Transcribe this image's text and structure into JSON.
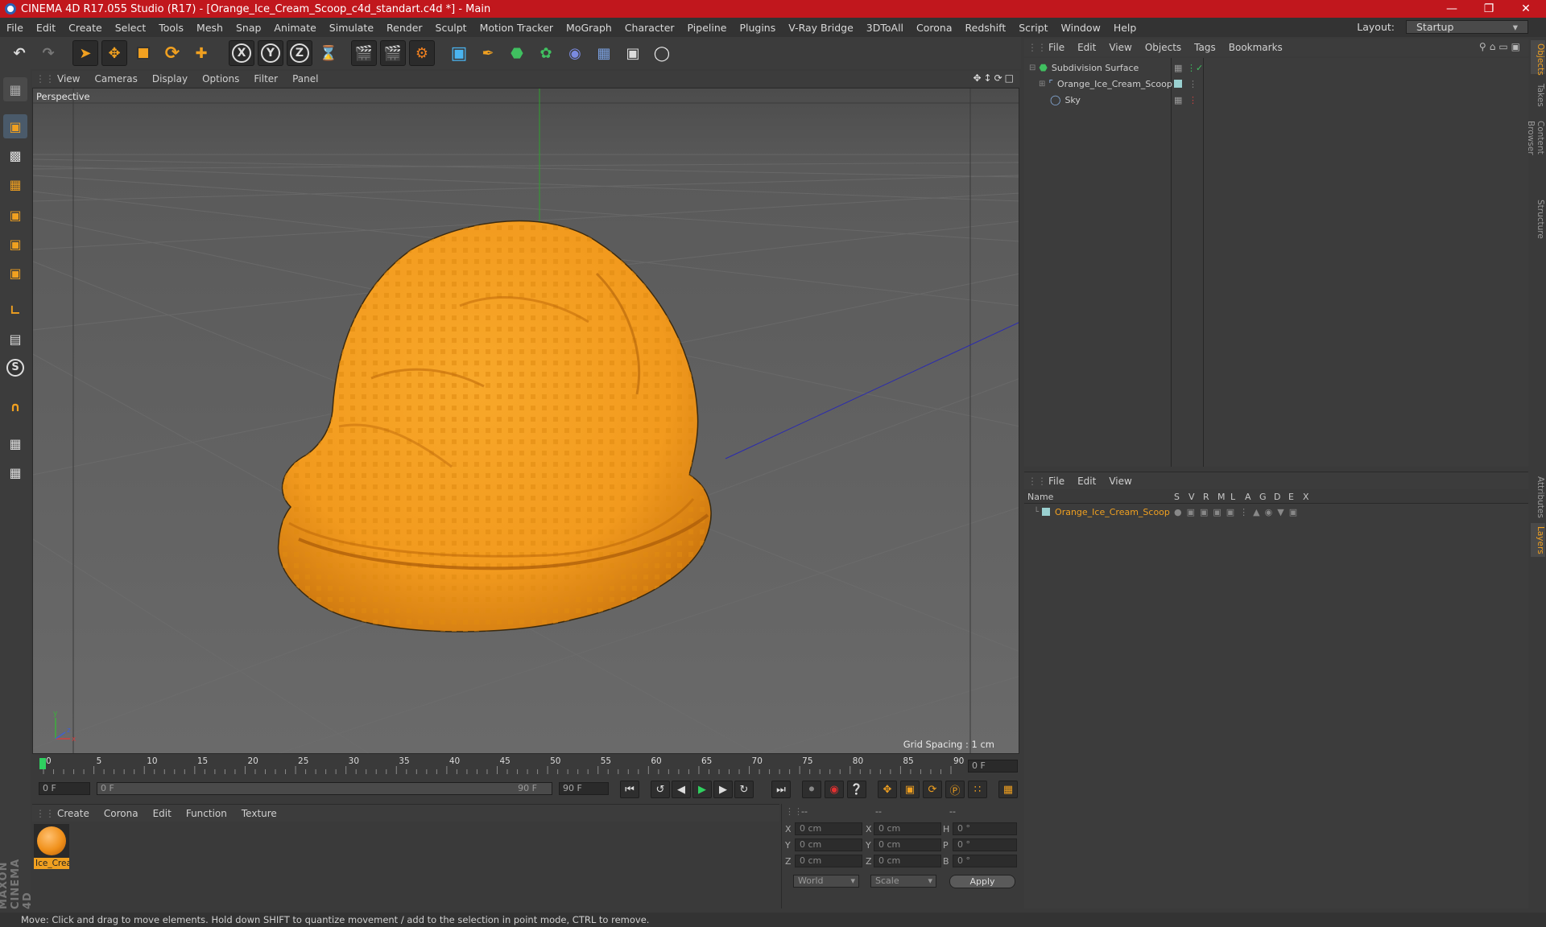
{
  "window": {
    "title": "CINEMA 4D R17.055 Studio (R17) - [Orange_Ice_Cream_Scoop_c4d_standart.c4d *] - Main"
  },
  "menubar": {
    "items": [
      "File",
      "Edit",
      "Create",
      "Select",
      "Tools",
      "Mesh",
      "Snap",
      "Animate",
      "Simulate",
      "Render",
      "Sculpt",
      "Motion Tracker",
      "MoGraph",
      "Character",
      "Pipeline",
      "Plugins",
      "V-Ray Bridge",
      "3DToAll",
      "Corona",
      "Redshift",
      "Script",
      "Window",
      "Help"
    ],
    "layout_label": "Layout:",
    "layout_value": "Startup"
  },
  "viewport": {
    "menu": [
      "View",
      "Cameras",
      "Display",
      "Options",
      "Filter",
      "Panel"
    ],
    "camera_label": "Perspective",
    "grid_spacing": "Grid Spacing : 1 cm"
  },
  "timeline": {
    "ticks": [
      "0",
      "5",
      "10",
      "15",
      "20",
      "25",
      "30",
      "35",
      "40",
      "45",
      "50",
      "55",
      "60",
      "65",
      "70",
      "75",
      "80",
      "85",
      "90"
    ],
    "current_frame": "0 F",
    "start_field": "0 F",
    "range_start": "0 F",
    "range_end": "90 F",
    "end_field": "90 F"
  },
  "material_manager": {
    "menu": [
      "Create",
      "Corona",
      "Edit",
      "Function",
      "Texture"
    ],
    "materials": [
      {
        "name": "Ice_Crea"
      }
    ]
  },
  "coordinates": {
    "header_left": "--",
    "header_mid": "--",
    "header_right": "--",
    "rows": [
      {
        "label": "X",
        "pos": "0 cm",
        "label2": "X",
        "size": "0 cm",
        "label3": "H",
        "rot": "0 °"
      },
      {
        "label": "Y",
        "pos": "0 cm",
        "label2": "Y",
        "size": "0 cm",
        "label3": "P",
        "rot": "0 °"
      },
      {
        "label": "Z",
        "pos": "0 cm",
        "label2": "Z",
        "size": "0 cm",
        "label3": "B",
        "rot": "0 °"
      }
    ],
    "mode_world": "World",
    "mode_scale": "Scale",
    "apply_label": "Apply"
  },
  "object_manager": {
    "menu": [
      "File",
      "Edit",
      "View",
      "Objects",
      "Tags",
      "Bookmarks"
    ],
    "objects": [
      {
        "name": "Subdivision Surface"
      },
      {
        "name": "Orange_Ice_Cream_Scoop"
      },
      {
        "name": "Sky"
      }
    ]
  },
  "layer_manager": {
    "menu": [
      "File",
      "Edit",
      "View"
    ],
    "columns": [
      "Name",
      "S",
      "V",
      "R",
      "M",
      "L",
      "A",
      "G",
      "D",
      "E",
      "X"
    ],
    "layers": [
      {
        "name": "Orange_Ice_Cream_Scoop"
      }
    ]
  },
  "side_tabs": [
    "Objects",
    "Takes",
    "Content Browser",
    "Structure",
    "Attributes",
    "Layers"
  ],
  "branding": "MAXON CINEMA 4D",
  "status": "Move: Click and drag to move elements. Hold down SHIFT to quantize movement / add to the selection in point mode, CTRL to remove.",
  "colors": {
    "titlebar": "#c1171d",
    "accent": "#f0a020",
    "scoop": "#f29a1e"
  }
}
